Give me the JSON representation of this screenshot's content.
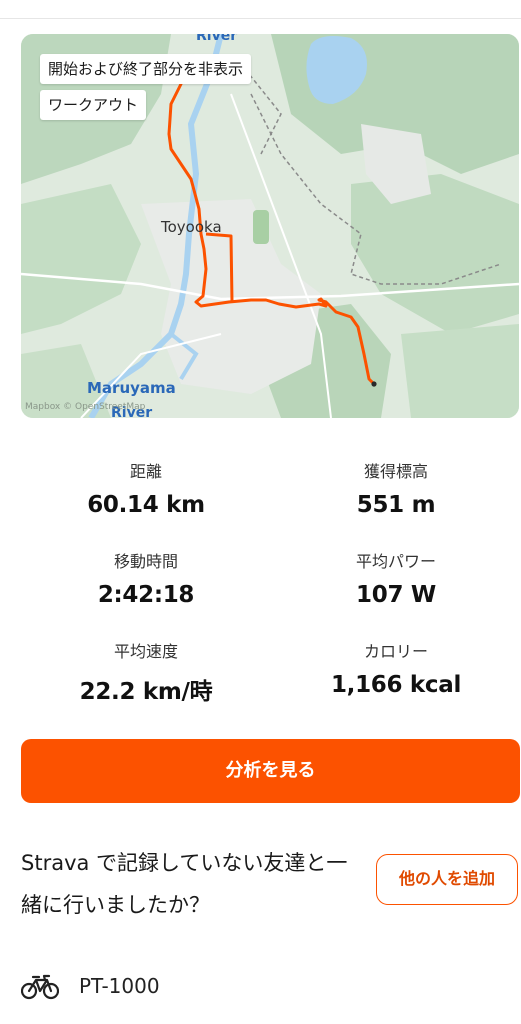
{
  "map": {
    "hide_start_end_label": "開始および終了部分を非表示",
    "workout_label": "ワークアウト",
    "city_label": "Toyooka",
    "river_name": "Maruyama",
    "river_word_bottom": "River",
    "river_word_top": "River",
    "attribution": "Mapbox © OpenStreetMap",
    "route_color": "#fc5200"
  },
  "stats": [
    {
      "label": "距離",
      "value": "60.14 km"
    },
    {
      "label": "獲得標高",
      "value": "551 m"
    },
    {
      "label": "移動時間",
      "value": "2:42:18"
    },
    {
      "label": "平均パワー",
      "value": "107 W"
    },
    {
      "label": "平均速度",
      "value": "22.2 km/時"
    },
    {
      "label": "カロリー",
      "value": "1,166 kcal"
    }
  ],
  "analyze_button": "分析を見る",
  "tag_prompt": {
    "text": "Strava で記録していない友達と一緒に行いましたか？",
    "button": "他の人を追加"
  },
  "gear": {
    "icon": "bike-icon",
    "name": "PT-1000"
  },
  "colors": {
    "accent": "#fc5200",
    "map_water": "#a9d2f0",
    "map_land": "#dfeade"
  }
}
